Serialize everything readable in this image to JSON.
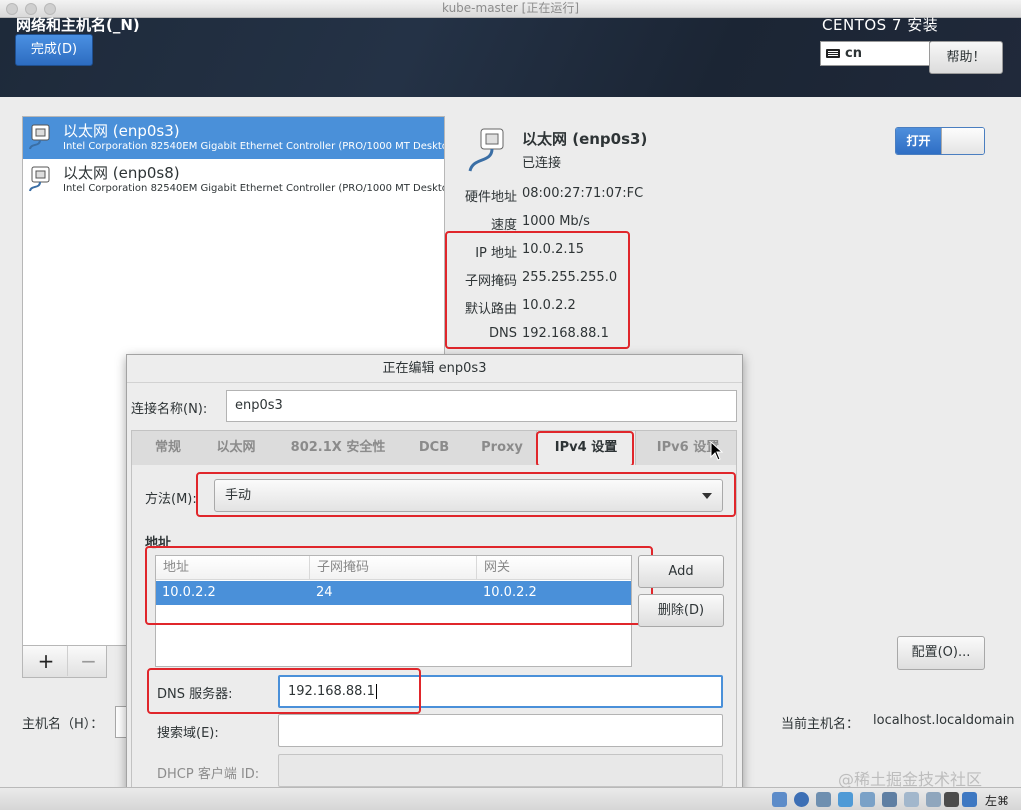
{
  "window": {
    "title": "kube-master [正在运行]"
  },
  "header": {
    "title": "网络和主机名(_N)",
    "done_label": "完成(D)",
    "product": "CENTOS 7 安装",
    "keyboard": "cn",
    "help_label": "帮助！"
  },
  "devices": [
    {
      "name": "以太网 (enp0s3)",
      "desc": "Intel Corporation 82540EM Gigabit Ethernet Controller (PRO/1000 MT Desktop Adapter)",
      "selected": true
    },
    {
      "name": "以太网 (enp0s8)",
      "desc": "Intel Corporation 82540EM Gigabit Ethernet Controller (PRO/1000 MT Desktop Adapter)",
      "selected": false
    }
  ],
  "list_tools": {
    "add": "+",
    "remove": "−"
  },
  "details": {
    "name": "以太网 (enp0s3)",
    "status": "已连接",
    "toggle_label": "打开",
    "hw_label": "硬件地址",
    "hw_value": "08:00:27:71:07:FC",
    "speed_label": "速度",
    "speed_value": "1000 Mb/s",
    "ip_label": "IP 地址",
    "ip_value": "10.0.2.15",
    "mask_label": "子网掩码",
    "mask_value": "255.255.255.0",
    "gw_label": "默认路由",
    "gw_value": "10.0.2.2",
    "dns_label": "DNS",
    "dns_value": "192.168.88.1",
    "config_label": "配置(O)..."
  },
  "hostname": {
    "label": "主机名（H）：",
    "current_label": "当前主机名：",
    "current_value": "localhost.localdomain"
  },
  "dialog": {
    "title": "正在编辑 enp0s3",
    "conn_name_label": "连接名称(N):",
    "conn_name_value": "enp0s3",
    "tabs": [
      "常规",
      "以太网",
      "802.1X 安全性",
      "DCB",
      "Proxy",
      "IPv4 设置",
      "IPv6 设置"
    ],
    "active_tab": "IPv4 设置",
    "method_label": "方法(M):",
    "method_value": "手动",
    "address_heading": "地址",
    "address_columns": [
      "地址",
      "子网掩码",
      "网关"
    ],
    "address_rows": [
      [
        "10.0.2.2",
        "24",
        "10.0.2.2"
      ]
    ],
    "add_label": "Add",
    "delete_label": "删除(D)",
    "dns_label": "DNS 服务器:",
    "dns_value": "192.168.88.1",
    "search_label": "搜索域(E):",
    "search_value": "",
    "dhcp_label": "DHCP 客户端 ID:"
  },
  "statusbar": {
    "host_key": "左⌘"
  },
  "watermark": "@稀土掘金技术社区",
  "colors": {
    "accent": "#4a90d9",
    "annotation": "#e0262b",
    "header_bg": "#1d2735"
  }
}
